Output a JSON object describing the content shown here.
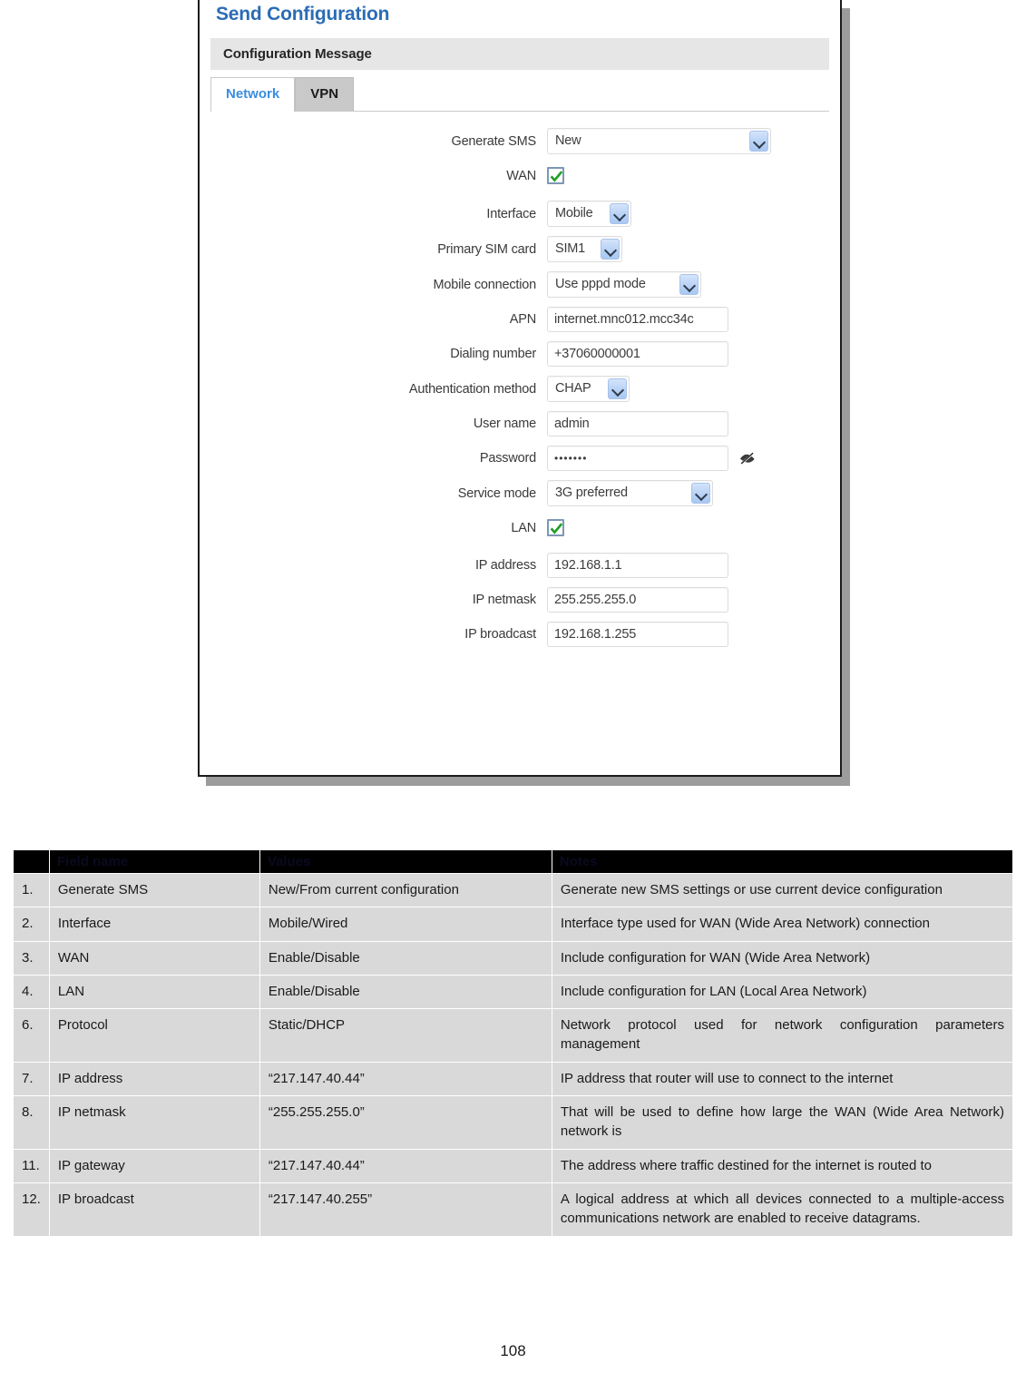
{
  "dialog": {
    "title": "Send Configuration",
    "section_header": "Configuration Message",
    "tabs": [
      {
        "label": "Network",
        "active": true
      },
      {
        "label": "VPN",
        "active": false
      }
    ],
    "fields": {
      "generate_sms": {
        "label": "Generate SMS",
        "type": "select",
        "value": "New"
      },
      "wan": {
        "label": "WAN",
        "type": "checkbox",
        "checked": true
      },
      "interface": {
        "label": "Interface",
        "type": "select",
        "value": "Mobile"
      },
      "primary_sim": {
        "label": "Primary SIM card",
        "type": "select",
        "value": "SIM1"
      },
      "mobile_conn": {
        "label": "Mobile connection",
        "type": "select",
        "value": "Use pppd mode"
      },
      "apn": {
        "label": "APN",
        "type": "text",
        "value": "internet.mnc012.mcc34c"
      },
      "dialing": {
        "label": "Dialing number",
        "type": "text",
        "value": "+37060000001"
      },
      "auth_method": {
        "label": "Authentication method",
        "type": "select",
        "value": "CHAP"
      },
      "user_name": {
        "label": "User name",
        "type": "text",
        "value": "admin"
      },
      "password": {
        "label": "Password",
        "type": "password",
        "value": "•••••••",
        "toggle_icon": "eye-slash-icon"
      },
      "service_mode": {
        "label": "Service mode",
        "type": "select",
        "value": "3G preferred"
      },
      "lan": {
        "label": "LAN",
        "type": "checkbox",
        "checked": true
      },
      "ip_address": {
        "label": "IP address",
        "type": "text",
        "value": "192.168.1.1"
      },
      "ip_netmask": {
        "label": "IP netmask",
        "type": "text",
        "value": "255.255.255.0"
      },
      "ip_broadcast": {
        "label": "IP broadcast",
        "type": "text",
        "value": "192.168.1.255"
      }
    },
    "colors": {
      "title_blue": "#2b6cb5",
      "tab_active_blue": "#3b8ddd",
      "check_green": "#1f9e28",
      "section_grey": "#e6e6e6"
    }
  },
  "table": {
    "headers": [
      "",
      "Field name",
      "Values",
      "Notes"
    ],
    "rows": [
      {
        "num": "1.",
        "field": "Generate SMS",
        "value": "New/From current configuration",
        "note": "Generate new SMS settings or use current device configuration"
      },
      {
        "num": "2.",
        "field": "Interface",
        "value": "Mobile/Wired",
        "note": "Interface type used for WAN (Wide Area Network) connection"
      },
      {
        "num": "3.",
        "field": "WAN",
        "value": "Enable/Disable",
        "note": "Include configuration for WAN (Wide Area Network)"
      },
      {
        "num": "4.",
        "field": "LAN",
        "value": "Enable/Disable",
        "note": "Include configuration for LAN (Local Area Network)"
      },
      {
        "num": "6.",
        "field": "Protocol",
        "value": "Static/DHCP",
        "note": "Network protocol used for network configuration parameters management"
      },
      {
        "num": "7.",
        "field": "IP address",
        "value": "“217.147.40.44”",
        "note": "IP address that router will use to connect to the internet"
      },
      {
        "num": "8.",
        "field": "IP netmask",
        "value": "“255.255.255.0”",
        "note": "That will be used to define how large the WAN (Wide Area Network) network is"
      },
      {
        "num": "11.",
        "field": "IP gateway",
        "value": "“217.147.40.44”",
        "note": "The address where traffic destined for the internet is routed to"
      },
      {
        "num": "12.",
        "field": "IP broadcast",
        "value": "“217.147.40.255”",
        "note": "A logical address at which all devices connected to a multiple-access communications network are enabled to receive datagrams."
      }
    ]
  },
  "footer": {
    "page_number": "108"
  }
}
